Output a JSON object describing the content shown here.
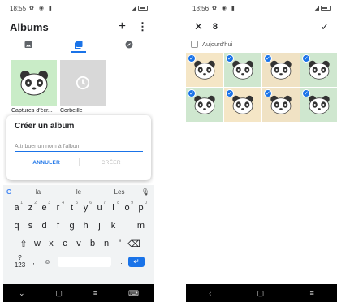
{
  "left_screen": {
    "status": {
      "time": "18:55"
    },
    "header": {
      "title": "Albums",
      "add_icon": "+",
      "more_icon": "⋮"
    },
    "tabs": [
      {
        "icon": "photo-icon"
      },
      {
        "icon": "albums-icon",
        "active": true
      },
      {
        "icon": "explore-icon"
      }
    ],
    "albums": [
      {
        "label": "Captures d'écr...",
        "thumb": "panda-thumbnail"
      },
      {
        "label": "Corbeille",
        "thumb": "trash-thumbnail"
      }
    ],
    "dialog": {
      "title": "Créer un album",
      "input_placeholder": "Attribuer un nom à l'album",
      "cancel_label": "ANNULER",
      "create_label": "CRÉER"
    },
    "keyboard": {
      "suggestions": [
        "la",
        "le",
        "Les"
      ],
      "row1": [
        {
          "key": "a",
          "sup": "1"
        },
        {
          "key": "z",
          "sup": "2"
        },
        {
          "key": "e",
          "sup": "3"
        },
        {
          "key": "r",
          "sup": "4"
        },
        {
          "key": "t",
          "sup": "5"
        },
        {
          "key": "y",
          "sup": "6"
        },
        {
          "key": "u",
          "sup": "7"
        },
        {
          "key": "i",
          "sup": "8"
        },
        {
          "key": "o",
          "sup": "9"
        },
        {
          "key": "p",
          "sup": "0"
        }
      ],
      "row2": [
        "q",
        "s",
        "d",
        "f",
        "g",
        "h",
        "j",
        "k",
        "l",
        "m"
      ],
      "row3": [
        "w",
        "x",
        "c",
        "v",
        "b",
        "n",
        "'"
      ],
      "bottom": {
        "symbols_label": "?123",
        "comma": ",",
        "period": "."
      }
    }
  },
  "right_screen": {
    "status": {
      "time": "18:56"
    },
    "header": {
      "selected_count": "8"
    },
    "date_label": "Aujourd'hui",
    "photos": [
      {
        "bg": "#f5e6c6",
        "selected": true
      },
      {
        "bg": "#cfe7cf",
        "selected": true
      },
      {
        "bg": "#f0e2c4",
        "selected": true
      },
      {
        "bg": "#cfe7cf",
        "selected": true
      },
      {
        "bg": "#cfe7cf",
        "selected": true
      },
      {
        "bg": "#f5e6c6",
        "selected": true
      },
      {
        "bg": "#f0e2c4",
        "selected": true
      },
      {
        "bg": "#cfe7cf",
        "selected": true
      }
    ]
  },
  "colors": {
    "accent": "#1a73e8",
    "keyboard_bg": "#f1f3f4",
    "navbar_bg": "#000000"
  }
}
